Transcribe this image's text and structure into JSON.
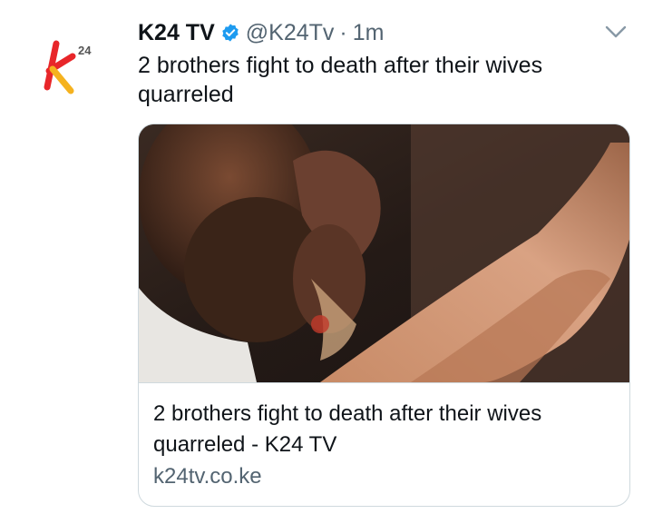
{
  "account": {
    "name": "K24 TV",
    "handle": "@K24Tv",
    "separator": "·",
    "time": "1m",
    "verified": true,
    "avatar_icon": "k24-logo-icon",
    "avatar_colors": {
      "k": "#e8262a",
      "accent": "#f5b21f",
      "label": "#555555"
    },
    "avatar_logo_text": "24"
  },
  "tweet": {
    "text": "2 brothers fight to death after their wives quarreled"
  },
  "card": {
    "title": "2 brothers fight to death after their wives quarreled - K24 TV",
    "domain": "k24tv.co.ke",
    "image_icon": "article-photo"
  },
  "menu_icon": "chevron-down-icon",
  "colors": {
    "verified": "#1d9bf0",
    "secondary_text": "#536471",
    "border": "#cfd9de"
  }
}
